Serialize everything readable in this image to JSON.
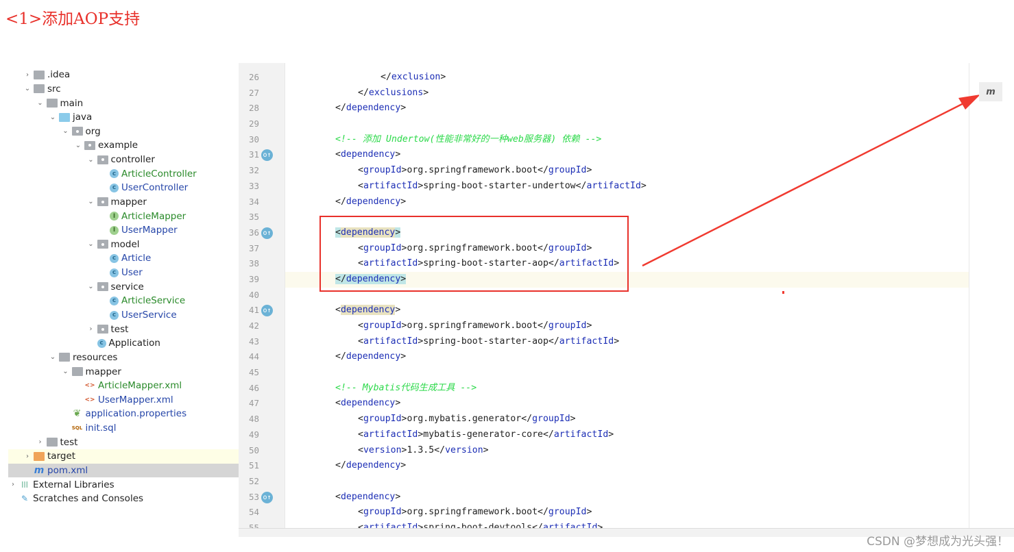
{
  "caption": "<1>添加AOP支持",
  "watermark": "CSDN @梦想成为光头强！",
  "maven_icon": "m",
  "tree": [
    {
      "label": ".idea",
      "depth": 0,
      "chev": ">",
      "icon": "folder",
      "color": "#222"
    },
    {
      "label": "src",
      "depth": 0,
      "chev": "v",
      "icon": "folder",
      "color": "#222"
    },
    {
      "label": "main",
      "depth": 1,
      "chev": "v",
      "icon": "folder",
      "color": "#222"
    },
    {
      "label": "java",
      "depth": 2,
      "chev": "v",
      "icon": "folder-blue",
      "color": "#222"
    },
    {
      "label": "org",
      "depth": 3,
      "chev": "v",
      "icon": "package",
      "color": "#222"
    },
    {
      "label": "example",
      "depth": 4,
      "chev": "v",
      "icon": "package",
      "color": "#222"
    },
    {
      "label": "controller",
      "depth": 5,
      "chev": "v",
      "icon": "package",
      "color": "#222"
    },
    {
      "label": "ArticleController",
      "depth": 6,
      "chev": "",
      "icon": "class",
      "color": "#2a8a2a"
    },
    {
      "label": "UserController",
      "depth": 6,
      "chev": "",
      "icon": "class",
      "color": "#2545a8"
    },
    {
      "label": "mapper",
      "depth": 5,
      "chev": "v",
      "icon": "package",
      "color": "#222"
    },
    {
      "label": "ArticleMapper",
      "depth": 6,
      "chev": "",
      "icon": "interface",
      "color": "#2a8a2a"
    },
    {
      "label": "UserMapper",
      "depth": 6,
      "chev": "",
      "icon": "interface",
      "color": "#2545a8"
    },
    {
      "label": "model",
      "depth": 5,
      "chev": "v",
      "icon": "package",
      "color": "#222"
    },
    {
      "label": "Article",
      "depth": 6,
      "chev": "",
      "icon": "class",
      "color": "#2545a8"
    },
    {
      "label": "User",
      "depth": 6,
      "chev": "",
      "icon": "class",
      "color": "#2545a8"
    },
    {
      "label": "service",
      "depth": 5,
      "chev": "v",
      "icon": "package",
      "color": "#222"
    },
    {
      "label": "ArticleService",
      "depth": 6,
      "chev": "",
      "icon": "class",
      "color": "#2a8a2a"
    },
    {
      "label": "UserService",
      "depth": 6,
      "chev": "",
      "icon": "class",
      "color": "#2545a8"
    },
    {
      "label": "test",
      "depth": 5,
      "chev": ">",
      "icon": "package",
      "color": "#222"
    },
    {
      "label": "Application",
      "depth": 5,
      "chev": "",
      "icon": "class",
      "color": "#222"
    },
    {
      "label": "resources",
      "depth": 2,
      "chev": "v",
      "icon": "folder",
      "color": "#222"
    },
    {
      "label": "mapper",
      "depth": 3,
      "chev": "v",
      "icon": "folder",
      "color": "#222"
    },
    {
      "label": "ArticleMapper.xml",
      "depth": 4,
      "chev": "",
      "icon": "xml",
      "color": "#2a8a2a"
    },
    {
      "label": "UserMapper.xml",
      "depth": 4,
      "chev": "",
      "icon": "xml",
      "color": "#2545a8"
    },
    {
      "label": "application.properties",
      "depth": 3,
      "chev": "",
      "icon": "leaf",
      "color": "#2545a8"
    },
    {
      "label": "init.sql",
      "depth": 3,
      "chev": "",
      "icon": "sql",
      "color": "#2545a8"
    },
    {
      "label": "test",
      "depth": 1,
      "chev": ">",
      "icon": "folder",
      "color": "#222"
    },
    {
      "label": "target",
      "depth": 0,
      "chev": ">",
      "icon": "folder-orange",
      "color": "#222",
      "state": "highlighted"
    },
    {
      "label": "pom.xml",
      "depth": 0,
      "chev": "",
      "icon": "maven",
      "color": "#2545a8",
      "state": "selected"
    },
    {
      "label": "External Libraries",
      "depth": -1,
      "chev": ">",
      "icon": "library",
      "color": "#222"
    },
    {
      "label": "Scratches and Consoles",
      "depth": -1,
      "chev": "",
      "icon": "scratch",
      "color": "#222"
    }
  ],
  "code": [
    {
      "n": "26",
      "i": 2,
      "p": [
        [
          "</",
          "pun"
        ],
        [
          "exclusion",
          "tag"
        ],
        [
          ">",
          "pun"
        ]
      ]
    },
    {
      "n": "27",
      "i": 1,
      "p": [
        [
          "</",
          "pun"
        ],
        [
          "exclusions",
          "tag"
        ],
        [
          ">",
          "pun"
        ]
      ]
    },
    {
      "n": "28",
      "i": 0,
      "p": [
        [
          "</",
          "pun"
        ],
        [
          "dependency",
          "tag"
        ],
        [
          ">",
          "pun"
        ]
      ]
    },
    {
      "n": "29",
      "i": 0,
      "p": []
    },
    {
      "n": "30",
      "i": 0,
      "p": [
        [
          "<!-- 添加 Undertow(性能非常好的一种web服务器) 依赖 -->",
          "cmt"
        ]
      ]
    },
    {
      "n": "31",
      "i": 0,
      "g": true,
      "p": [
        [
          "<",
          "pun"
        ],
        [
          "dependency",
          "tag"
        ],
        [
          ">",
          "pun"
        ]
      ]
    },
    {
      "n": "32",
      "i": 1,
      "p": [
        [
          "<",
          "pun"
        ],
        [
          "groupId",
          "tag"
        ],
        [
          ">org.springframework.boot</",
          "pun"
        ],
        [
          "groupId",
          "tag"
        ],
        [
          ">",
          "pun"
        ]
      ]
    },
    {
      "n": "33",
      "i": 1,
      "p": [
        [
          "<",
          "pun"
        ],
        [
          "artifactId",
          "tag"
        ],
        [
          ">spring-boot-starter-undertow</",
          "pun"
        ],
        [
          "artifactId",
          "tag"
        ],
        [
          ">",
          "pun"
        ]
      ]
    },
    {
      "n": "34",
      "i": 0,
      "p": [
        [
          "</",
          "pun"
        ],
        [
          "dependency",
          "tag"
        ],
        [
          ">",
          "pun"
        ]
      ]
    },
    {
      "n": "35",
      "i": 0,
      "p": []
    },
    {
      "n": "36",
      "i": 0,
      "g": true,
      "p": [
        [
          "<",
          "pun mk2"
        ],
        [
          "dependency",
          "tag mk"
        ],
        [
          ">",
          "pun mk2"
        ]
      ]
    },
    {
      "n": "37",
      "i": 1,
      "p": [
        [
          "<",
          "pun"
        ],
        [
          "groupId",
          "tag"
        ],
        [
          ">org.springframework.boot</",
          "pun"
        ],
        [
          "groupId",
          "tag"
        ],
        [
          ">",
          "pun"
        ]
      ]
    },
    {
      "n": "38",
      "i": 1,
      "p": [
        [
          "<",
          "pun"
        ],
        [
          "artifactId",
          "tag"
        ],
        [
          ">spring-boot-starter-aop</",
          "pun"
        ],
        [
          "artifactId",
          "tag"
        ],
        [
          ">",
          "pun"
        ]
      ]
    },
    {
      "n": "39",
      "i": 0,
      "cur": true,
      "p": [
        [
          "</",
          "pun mk2"
        ],
        [
          "dependency",
          "tag mk2"
        ],
        [
          ">",
          "pun mk2"
        ]
      ]
    },
    {
      "n": "40",
      "i": 0,
      "p": []
    },
    {
      "n": "41",
      "i": 0,
      "g": true,
      "p": [
        [
          "<",
          "pun"
        ],
        [
          "dependency",
          "tag mk"
        ],
        [
          ">",
          "pun"
        ]
      ]
    },
    {
      "n": "42",
      "i": 1,
      "p": [
        [
          "<",
          "pun"
        ],
        [
          "groupId",
          "tag"
        ],
        [
          ">org.springframework.boot</",
          "pun"
        ],
        [
          "groupId",
          "tag"
        ],
        [
          ">",
          "pun"
        ]
      ]
    },
    {
      "n": "43",
      "i": 1,
      "p": [
        [
          "<",
          "pun"
        ],
        [
          "artifactId",
          "tag"
        ],
        [
          ">spring-boot-starter-aop</",
          "pun"
        ],
        [
          "artifactId",
          "tag"
        ],
        [
          ">",
          "pun"
        ]
      ]
    },
    {
      "n": "44",
      "i": 0,
      "p": [
        [
          "</",
          "pun"
        ],
        [
          "dependency",
          "tag"
        ],
        [
          ">",
          "pun"
        ]
      ]
    },
    {
      "n": "45",
      "i": 0,
      "p": []
    },
    {
      "n": "46",
      "i": 0,
      "p": [
        [
          "<!-- Mybatis代码生成工具 -->",
          "cmt"
        ]
      ]
    },
    {
      "n": "47",
      "i": 0,
      "p": [
        [
          "<",
          "pun"
        ],
        [
          "dependency",
          "tag"
        ],
        [
          ">",
          "pun"
        ]
      ]
    },
    {
      "n": "48",
      "i": 1,
      "p": [
        [
          "<",
          "pun"
        ],
        [
          "groupId",
          "tag"
        ],
        [
          ">org.mybatis.generator</",
          "pun"
        ],
        [
          "groupId",
          "tag"
        ],
        [
          ">",
          "pun"
        ]
      ]
    },
    {
      "n": "49",
      "i": 1,
      "p": [
        [
          "<",
          "pun"
        ],
        [
          "artifactId",
          "tag"
        ],
        [
          ">mybatis-generator-core</",
          "pun"
        ],
        [
          "artifactId",
          "tag"
        ],
        [
          ">",
          "pun"
        ]
      ]
    },
    {
      "n": "50",
      "i": 1,
      "p": [
        [
          "<",
          "pun"
        ],
        [
          "version",
          "tag"
        ],
        [
          ">1.3.5</",
          "pun"
        ],
        [
          "version",
          "tag"
        ],
        [
          ">",
          "pun"
        ]
      ]
    },
    {
      "n": "51",
      "i": 0,
      "p": [
        [
          "</",
          "pun"
        ],
        [
          "dependency",
          "tag"
        ],
        [
          ">",
          "pun"
        ]
      ]
    },
    {
      "n": "52",
      "i": 0,
      "p": []
    },
    {
      "n": "53",
      "i": 0,
      "g": true,
      "p": [
        [
          "<",
          "pun"
        ],
        [
          "dependency",
          "tag"
        ],
        [
          ">",
          "pun"
        ]
      ]
    },
    {
      "n": "54",
      "i": 1,
      "p": [
        [
          "<",
          "pun"
        ],
        [
          "groupId",
          "tag"
        ],
        [
          ">org.springframework.boot</",
          "pun"
        ],
        [
          "groupId",
          "tag"
        ],
        [
          ">",
          "pun"
        ]
      ]
    },
    {
      "n": "55",
      "i": 1,
      "p": [
        [
          "<",
          "pun"
        ],
        [
          "artifactId",
          "tag"
        ],
        [
          ">spring-boot-devtools</",
          "pun"
        ],
        [
          "artifactId",
          "tag"
        ],
        [
          ">",
          "pun"
        ]
      ]
    }
  ],
  "colors": {
    "annotation": "#e8302a",
    "comment": "#2cd94a",
    "tag": "#1c2eb5"
  }
}
